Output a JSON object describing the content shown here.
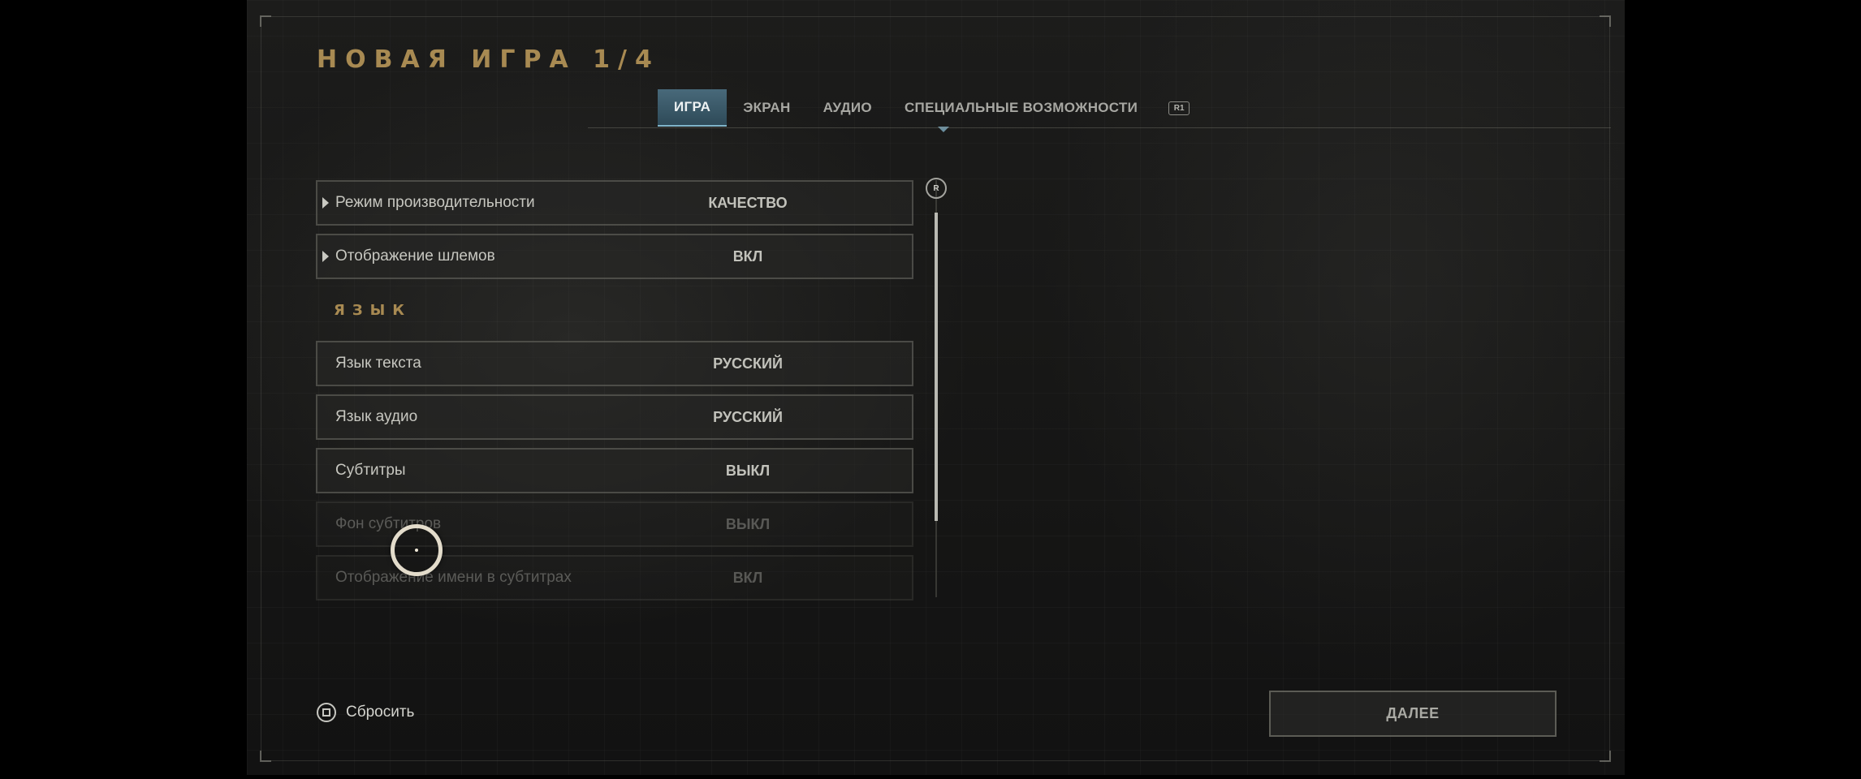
{
  "header": {
    "title": "НОВАЯ ИГРА 1/4"
  },
  "tabs": [
    {
      "label": "ИГРА",
      "active": true
    },
    {
      "label": "ЭКРАН",
      "active": false
    },
    {
      "label": "АУДИО",
      "active": false
    },
    {
      "label": "СПЕЦИАЛЬНЫЕ ВОЗМОЖНОСТИ",
      "active": false
    }
  ],
  "tab_switch_hint": "R1",
  "settings": {
    "rows": [
      {
        "label": "Режим производительности",
        "value": "КАЧЕСТВО",
        "expandable": true
      },
      {
        "label": "Отображение шлемов",
        "value": "ВКЛ",
        "expandable": true
      }
    ],
    "language_section": "ЯЗЫК",
    "language_rows": [
      {
        "label": "Язык текста",
        "value": "РУССКИЙ"
      },
      {
        "label": "Язык аудио",
        "value": "РУССКИЙ"
      },
      {
        "label": "Субтитры",
        "value": "ВЫКЛ"
      },
      {
        "label": "Фон субтитров",
        "value": "ВЫКЛ",
        "disabled": true
      },
      {
        "label": "Отображение имени в субтитрах",
        "value": "ВКЛ",
        "disabled": true
      }
    ]
  },
  "scroll_hint": "R",
  "footer": {
    "reset_label": "Сбросить",
    "next_label": "ДАЛЕЕ"
  },
  "colors": {
    "accent_gold": "#a88a52",
    "active_tab": "#48697a"
  }
}
